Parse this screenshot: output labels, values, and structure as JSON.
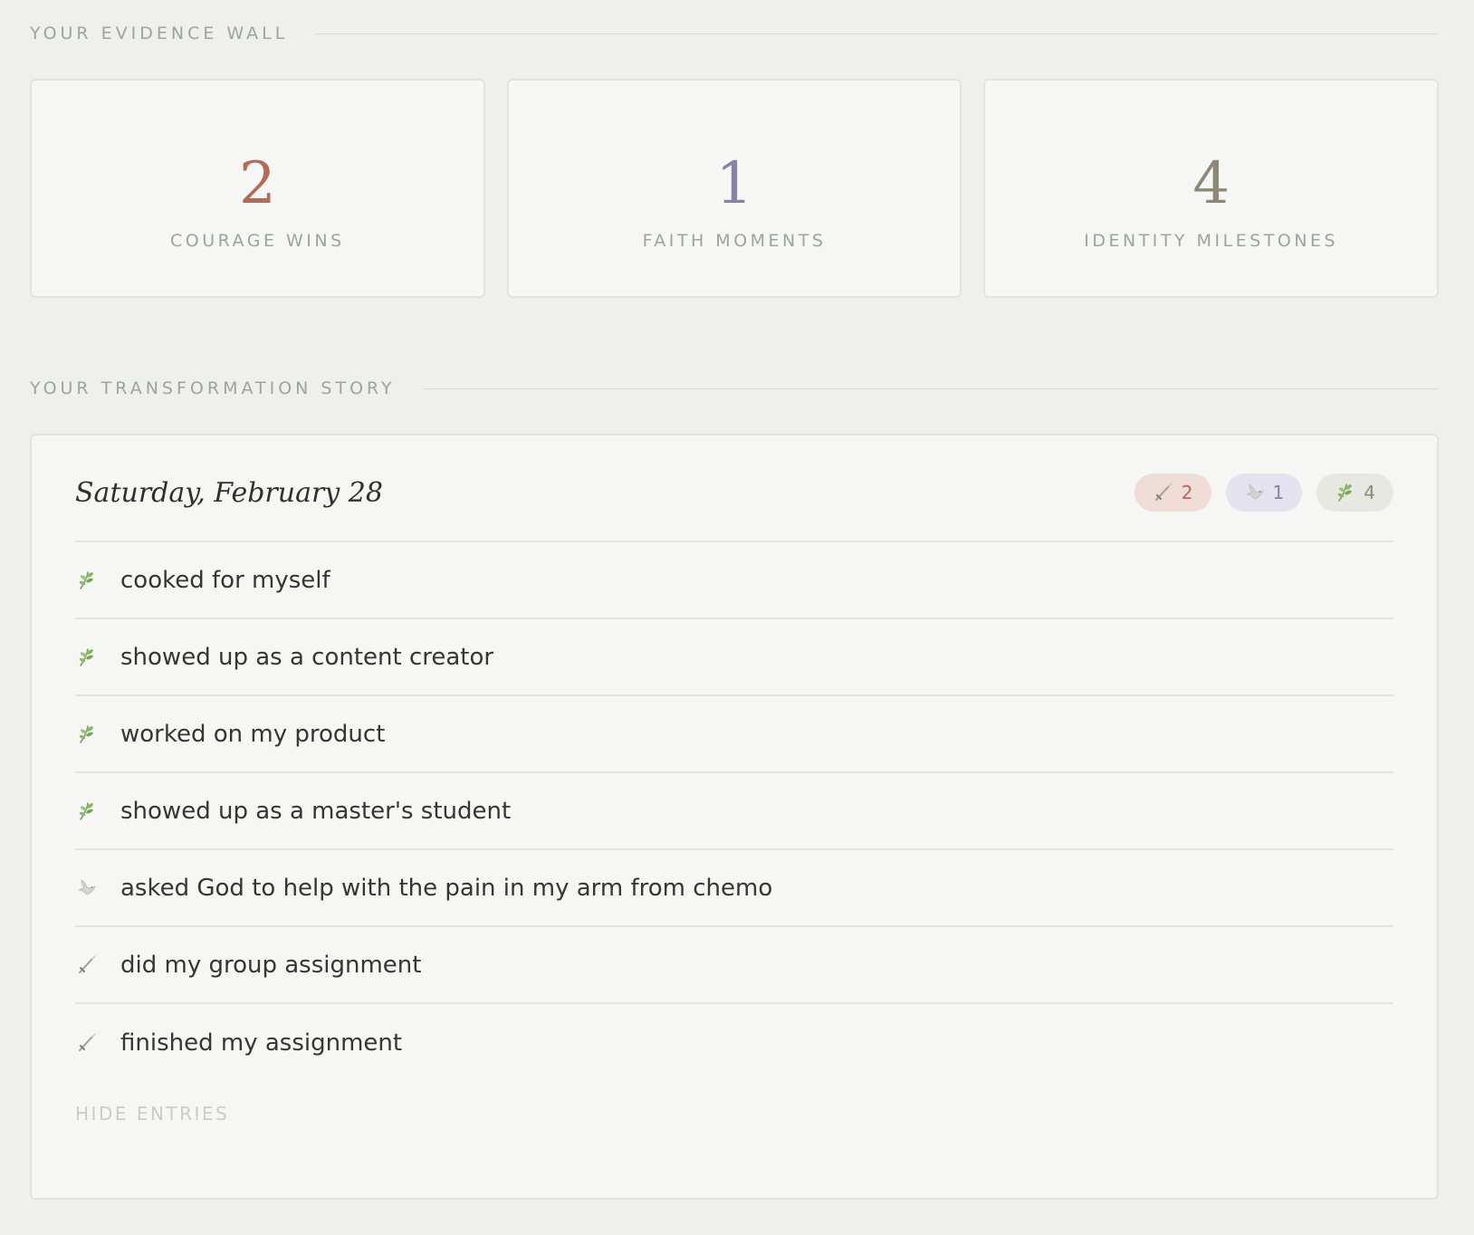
{
  "evidence_wall": {
    "header": "YOUR EVIDENCE WALL",
    "stats": [
      {
        "value": "2",
        "label": "COURAGE WINS",
        "color": "#b46a56"
      },
      {
        "value": "1",
        "label": "FAITH MOMENTS",
        "color": "#8883a6"
      },
      {
        "value": "4",
        "label": "IDENTITY MILESTONES",
        "color": "#8e8778"
      }
    ]
  },
  "story": {
    "header": "YOUR TRANSFORMATION STORY",
    "date": "Saturday, February 28",
    "badges": [
      {
        "icon": "sword-icon",
        "count": "2",
        "bg": "#f0dcd7",
        "color": "#b46a56"
      },
      {
        "icon": "dove-icon",
        "count": "1",
        "bg": "#e3e2ee",
        "color": "#8883a6"
      },
      {
        "icon": "leaf-icon",
        "count": "4",
        "bg": "#e8e8e2",
        "color": "#8e8778"
      }
    ],
    "entries": [
      {
        "icon": "leaf-icon",
        "text": "cooked for myself"
      },
      {
        "icon": "leaf-icon",
        "text": "showed up as a content creator"
      },
      {
        "icon": "leaf-icon",
        "text": "worked on my product"
      },
      {
        "icon": "leaf-icon",
        "text": "showed up as a master's student"
      },
      {
        "icon": "dove-icon",
        "text": "asked God to help with the pain in my arm from chemo"
      },
      {
        "icon": "sword-icon",
        "text": "did my group assignment"
      },
      {
        "icon": "sword-icon",
        "text": "finished my assignment"
      }
    ],
    "hide_label": "HIDE ENTRIES"
  }
}
